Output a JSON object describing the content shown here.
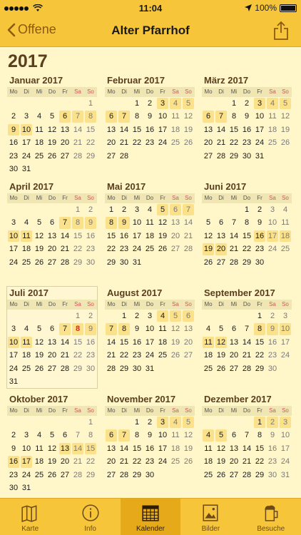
{
  "status": {
    "time": "11:04",
    "battery": "100%"
  },
  "nav": {
    "back": "Offene",
    "title": "Alter Pfarrhof"
  },
  "year": "2017",
  "weekdays": [
    "Mo",
    "Di",
    "Mi",
    "Do",
    "Fr",
    "Sa",
    "So"
  ],
  "months": [
    {
      "name": "Januar 2017",
      "offset": 6,
      "length": 31,
      "highlights": [
        6,
        7,
        8,
        9,
        10
      ]
    },
    {
      "name": "Februar 2017",
      "offset": 2,
      "length": 28,
      "highlights": [
        3,
        4,
        5,
        6,
        7
      ]
    },
    {
      "name": "März 2017",
      "offset": 2,
      "length": 31,
      "highlights": [
        3,
        4,
        5,
        6,
        7
      ]
    },
    {
      "name": "April 2017",
      "offset": 5,
      "length": 30,
      "highlights": [
        7,
        8,
        9,
        10,
        11
      ]
    },
    {
      "name": "Mai 2017",
      "offset": 0,
      "length": 31,
      "highlights": [
        5,
        6,
        7,
        8,
        9
      ]
    },
    {
      "name": "Juni 2017",
      "offset": 3,
      "length": 30,
      "highlights": [
        16,
        17,
        18,
        19,
        20
      ]
    },
    {
      "name": "Juli 2017",
      "offset": 5,
      "length": 31,
      "highlights": [
        7,
        8,
        9,
        10,
        11
      ],
      "today": 8
    },
    {
      "name": "August 2017",
      "offset": 1,
      "length": 31,
      "highlights": [
        4,
        5,
        6,
        7,
        8
      ]
    },
    {
      "name": "September 2017",
      "offset": 4,
      "length": 30,
      "highlights": [
        8,
        9,
        10,
        11,
        12
      ]
    },
    {
      "name": "Oktober 2017",
      "offset": 6,
      "length": 31,
      "highlights": [
        13,
        14,
        15,
        16,
        17
      ]
    },
    {
      "name": "November 2017",
      "offset": 2,
      "length": 30,
      "highlights": [
        3,
        4,
        5,
        6,
        7
      ]
    },
    {
      "name": "Dezember 2017",
      "offset": 4,
      "length": 31,
      "highlights": [
        1,
        2,
        3,
        4,
        5
      ]
    }
  ],
  "tabs": [
    {
      "label": "Karte",
      "icon": "map-icon"
    },
    {
      "label": "Info",
      "icon": "info-icon"
    },
    {
      "label": "Kalender",
      "icon": "calendar-icon",
      "active": true
    },
    {
      "label": "Bilder",
      "icon": "image-icon"
    },
    {
      "label": "Besuche",
      "icon": "beer-mug-icon"
    }
  ]
}
